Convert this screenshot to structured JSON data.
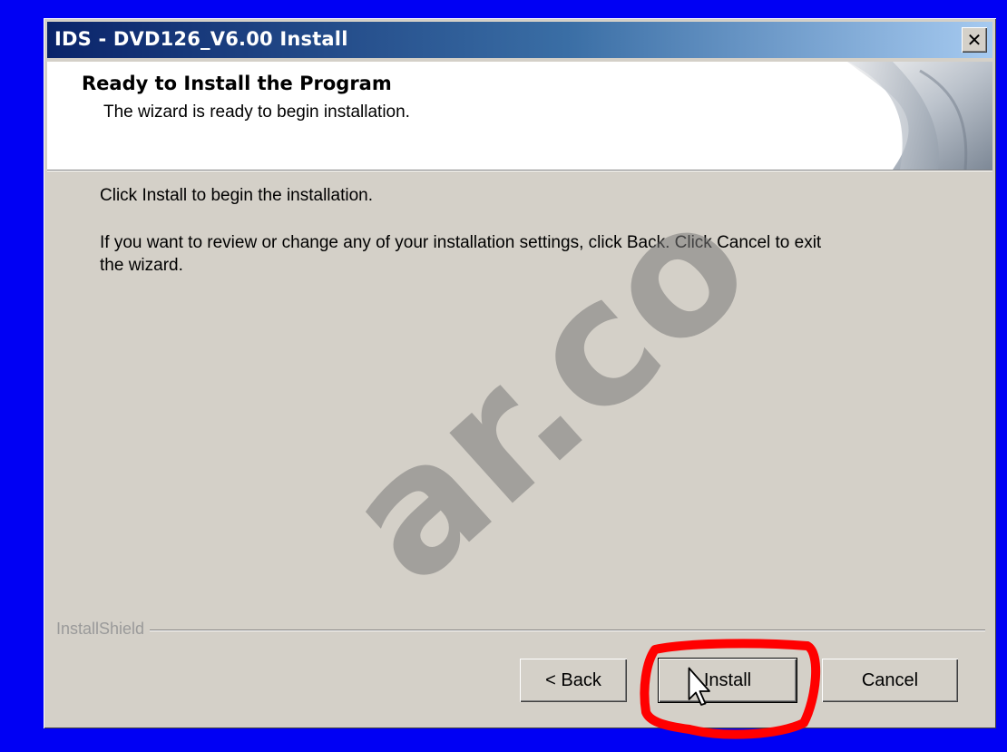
{
  "window": {
    "title": "IDS - DVD126_V6.00 Install",
    "close_glyph": "✕"
  },
  "banner": {
    "title": "Ready to Install the Program",
    "subtitle": "The wizard is ready to begin installation."
  },
  "body": {
    "line1": "Click Install to begin the installation.",
    "line2a": "If you want to review or change any of your installation settings, click Back. Click Cancel to exit",
    "line2b": "the wizard."
  },
  "footer": {
    "brand": "InstallShield"
  },
  "buttons": {
    "back": "< Back",
    "install": "Install",
    "cancel": "Cancel"
  },
  "overlay": {
    "watermark": "ar.co",
    "highlight_color": "#ff0000",
    "icons": [
      "close-icon",
      "arrow-cursor-icon",
      "page-curl-icon"
    ]
  },
  "colors": {
    "desktop": "#0000f4",
    "titlebar_start": "#0a246a",
    "titlebar_end": "#a6caf0",
    "dialog_face": "#d4d0c8"
  }
}
